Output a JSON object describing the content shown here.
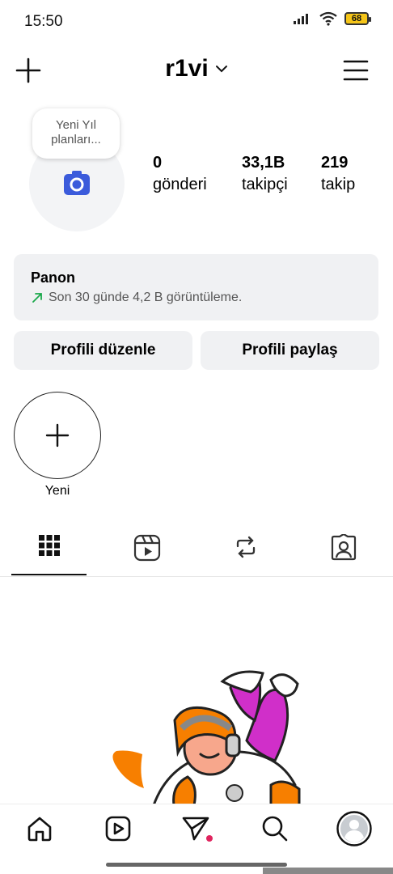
{
  "status_bar": {
    "time": "15:50",
    "battery": "68"
  },
  "header": {
    "username": "r1vi"
  },
  "profile": {
    "note": "Yeni Yıl planları...",
    "stats": [
      {
        "value": "0",
        "label": "gönderi"
      },
      {
        "value": "33,1B",
        "label": "takipçi"
      },
      {
        "value": "219",
        "label": "takip"
      }
    ]
  },
  "dashboard": {
    "title": "Panon",
    "subtitle": "Son 30 günde 4,2 B görüntüleme."
  },
  "actions": {
    "edit_profile": "Profili düzenle",
    "share_profile": "Profili paylaş"
  },
  "highlights": {
    "new_label": "Yeni"
  },
  "tabs": [
    "grid-icon",
    "reels-icon",
    "reposts-icon",
    "tagged-icon"
  ],
  "bottom_nav": [
    "home-icon",
    "reels-icon",
    "direct-messages-icon",
    "search-icon",
    "profile-avatar"
  ],
  "colors": {
    "accent": "#3b5bdb",
    "trend_green": "#19a84a",
    "button_bg": "#f0f1f3",
    "notification_dot": "#e0245e"
  }
}
